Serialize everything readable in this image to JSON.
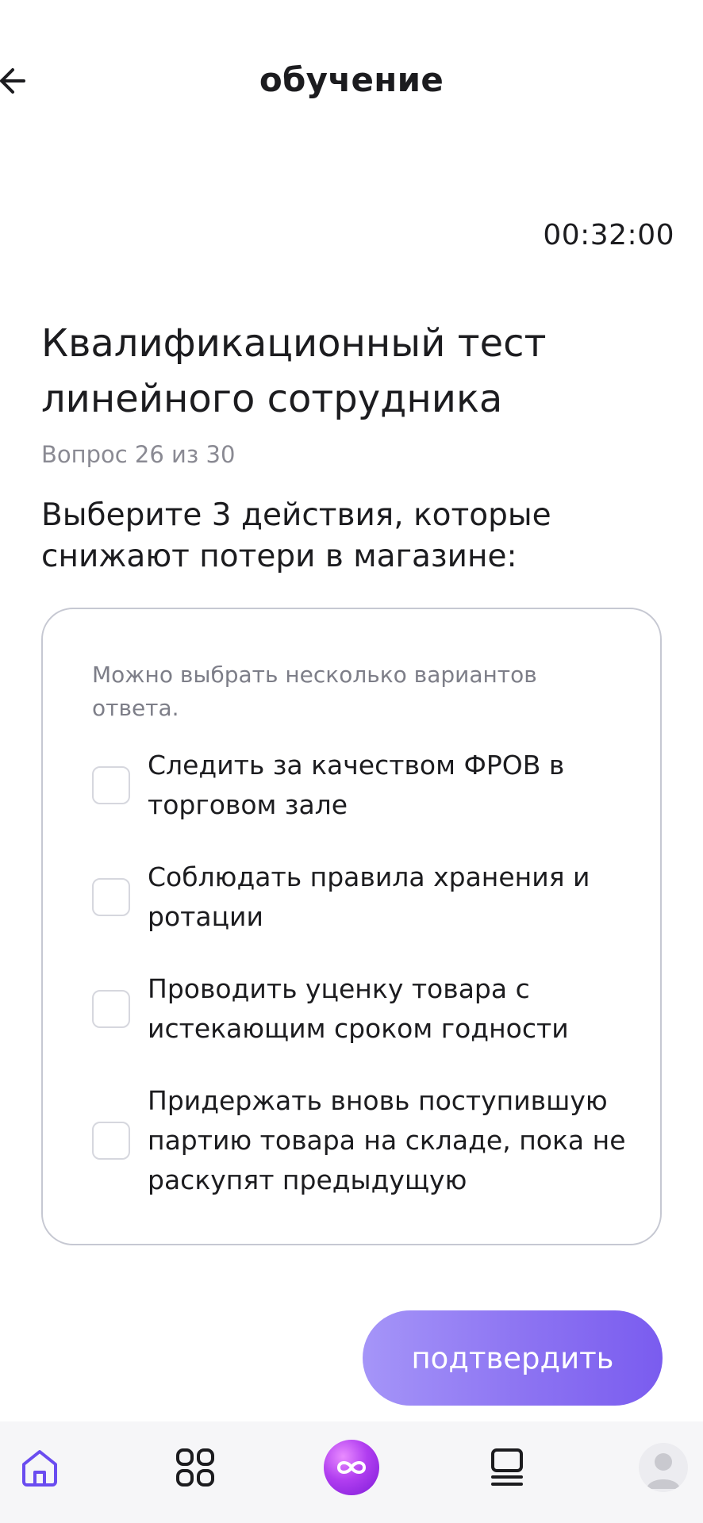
{
  "header": {
    "title": "обучение"
  },
  "timer": "00:32:00",
  "test": {
    "title": "Квалификационный тест линейного сотрудника",
    "counter": "Вопрос 26 из 30",
    "question": "Выберите 3 действия, которые снижают потери в магазине:"
  },
  "answers": {
    "hint": "Можно выбрать несколько вариантов ответа.",
    "options": [
      {
        "label": "Следить за качеством ФРОВ в торговом зале",
        "checked": false
      },
      {
        "label": "Соблюдать правила хранения и ротации",
        "checked": false
      },
      {
        "label": "Проводить уценку товара с истекающим сроком годности",
        "checked": false
      },
      {
        "label": "Придержать вновь поступившую партию товара на складе, пока не раскупят предыдущую",
        "checked": false
      }
    ]
  },
  "confirm_label": "подтвердить",
  "nav": {
    "items": [
      "home-icon",
      "grid-icon",
      "infinity-icon",
      "courses-icon",
      "profile-avatar"
    ],
    "active": "home-icon",
    "accent": "#6a4cf0"
  },
  "colors": {
    "accent": "#8c73f2",
    "card_border": "#c6c8d2",
    "muted_text": "#8a8a93"
  }
}
